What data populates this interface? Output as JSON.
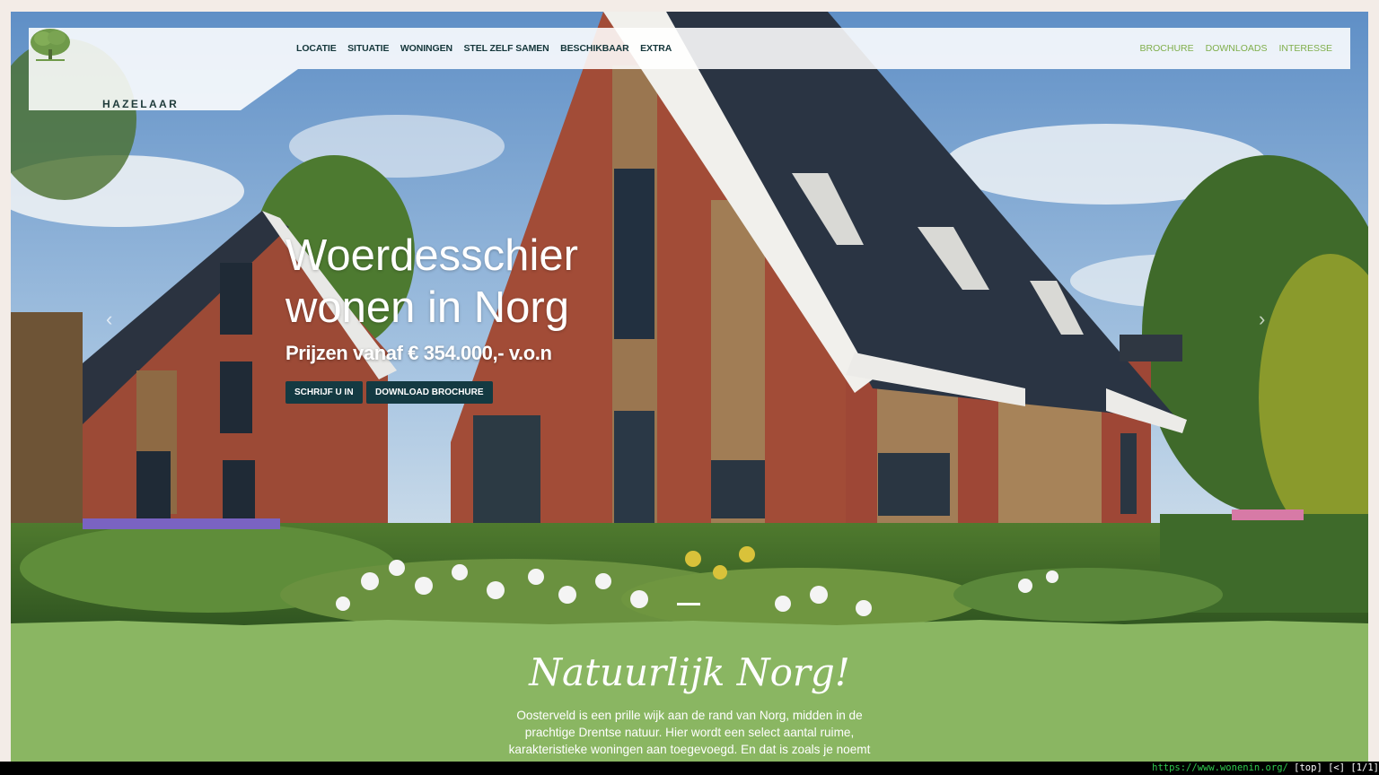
{
  "logo": {
    "word": "HAZELAAR"
  },
  "nav": {
    "items": [
      {
        "label": "LOCATIE"
      },
      {
        "label": "SITUATIE"
      },
      {
        "label": "WONINGEN"
      },
      {
        "label": "STEL ZELF SAMEN"
      },
      {
        "label": "BESCHIKBAAR"
      },
      {
        "label": "EXTRA"
      }
    ],
    "right_items": [
      {
        "label": "BROCHURE"
      },
      {
        "label": "DOWNLOADS"
      },
      {
        "label": "INTERESSE"
      }
    ]
  },
  "hero": {
    "title_line1": "Woerdesschier",
    "title_line2": "wonen in Norg",
    "subtitle": "Prijzen vanaf € 354.000,- v.o.n",
    "btn_signup": "SCHRIJF U IN",
    "btn_brochure": "DOWNLOAD BROCHURE",
    "arrow_left": "‹",
    "arrow_right": "›"
  },
  "section": {
    "title": "Natuurlijk Norg!",
    "text": "Oosterveld is een prille wijk aan de rand van Norg, midden in de prachtige Drentse natuur. Hier wordt een select aantal ruime, karakteristieke woningen aan toegevoegd. En dat is zoals je noemt"
  },
  "statusbar": {
    "url": "https://www.wonenin.org/",
    "info": " [top] [<] [1/1]"
  },
  "colors": {
    "accent_green": "#8ab662",
    "nav_dark": "#14363a",
    "button_bg": "#143a42"
  }
}
